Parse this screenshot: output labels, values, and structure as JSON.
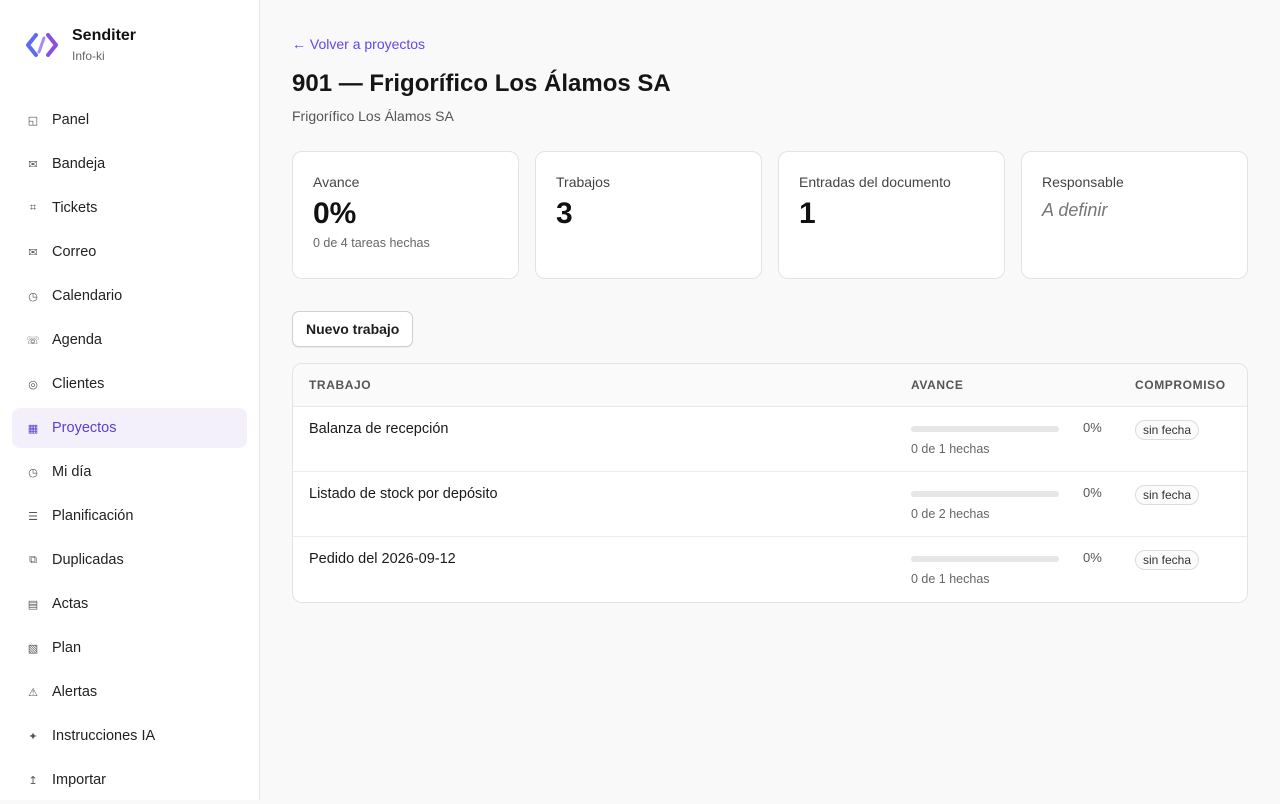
{
  "brand": {
    "name": "Senditer",
    "sub": "Info-ki"
  },
  "sidebar": {
    "items": [
      {
        "label": "Panel",
        "icon": "panel-icon",
        "glyph": "◱",
        "active": false
      },
      {
        "label": "Bandeja",
        "icon": "inbox-icon",
        "glyph": "✉",
        "active": false
      },
      {
        "label": "Tickets",
        "icon": "hash-icon",
        "glyph": "⌗",
        "active": false
      },
      {
        "label": "Correo",
        "icon": "mail-icon",
        "glyph": "✉",
        "active": false
      },
      {
        "label": "Calendario",
        "icon": "clock-icon",
        "glyph": "◷",
        "active": false
      },
      {
        "label": "Agenda",
        "icon": "phone-icon",
        "glyph": "☏",
        "active": false
      },
      {
        "label": "Clientes",
        "icon": "target-icon",
        "glyph": "◎",
        "active": false
      },
      {
        "label": "Proyectos",
        "icon": "grid-icon",
        "glyph": "▦",
        "active": true
      },
      {
        "label": "Mi día",
        "icon": "clock-icon",
        "glyph": "◷",
        "active": false
      },
      {
        "label": "Planificación",
        "icon": "list-icon",
        "glyph": "☰",
        "active": false
      },
      {
        "label": "Duplicadas",
        "icon": "duplicate-icon",
        "glyph": "⧉",
        "active": false
      },
      {
        "label": "Actas",
        "icon": "document-icon",
        "glyph": "▤",
        "active": false
      },
      {
        "label": "Plan",
        "icon": "plan-icon",
        "glyph": "▧",
        "active": false
      },
      {
        "label": "Alertas",
        "icon": "warning-icon",
        "glyph": "⚠",
        "active": false
      },
      {
        "label": "Instrucciones IA",
        "icon": "sparkle-icon",
        "glyph": "✦",
        "active": false
      },
      {
        "label": "Importar",
        "icon": "import-icon",
        "glyph": "↥",
        "active": false
      }
    ]
  },
  "header": {
    "back_label": "← Volver a proyectos",
    "title": "901 — Frigorífico Los Álamos SA",
    "subtitle": "Frigorífico Los Álamos SA"
  },
  "stats": [
    {
      "label": "Avance",
      "value": "0%",
      "note": "0 de 4 tareas hechas",
      "italic": false
    },
    {
      "label": "Trabajos",
      "value": "3",
      "note": "",
      "italic": false
    },
    {
      "label": "Entradas del documento",
      "value": "1",
      "note": "",
      "italic": false
    },
    {
      "label": "Responsable",
      "value": "A definir",
      "note": "",
      "italic": true
    }
  ],
  "actions": {
    "new_job": "Nuevo trabajo"
  },
  "table": {
    "headers": {
      "job": "TRABAJO",
      "progress": "AVANCE",
      "commitment": "COMPROMISO"
    },
    "rows": [
      {
        "name": "Balanza de recepción",
        "progress": 0,
        "pct": "0%",
        "done": "0 de 1 hechas",
        "commitment": "sin fecha"
      },
      {
        "name": "Listado de stock por depósito",
        "progress": 0,
        "pct": "0%",
        "done": "0 de 2 hechas",
        "commitment": "sin fecha"
      },
      {
        "name": "Pedido del 2026-09-12",
        "progress": 0,
        "pct": "0%",
        "done": "0 de 1 hechas",
        "commitment": "sin fecha"
      }
    ]
  },
  "colors": {
    "accent": "#6246ea",
    "active_bg": "#f3f0fc"
  }
}
